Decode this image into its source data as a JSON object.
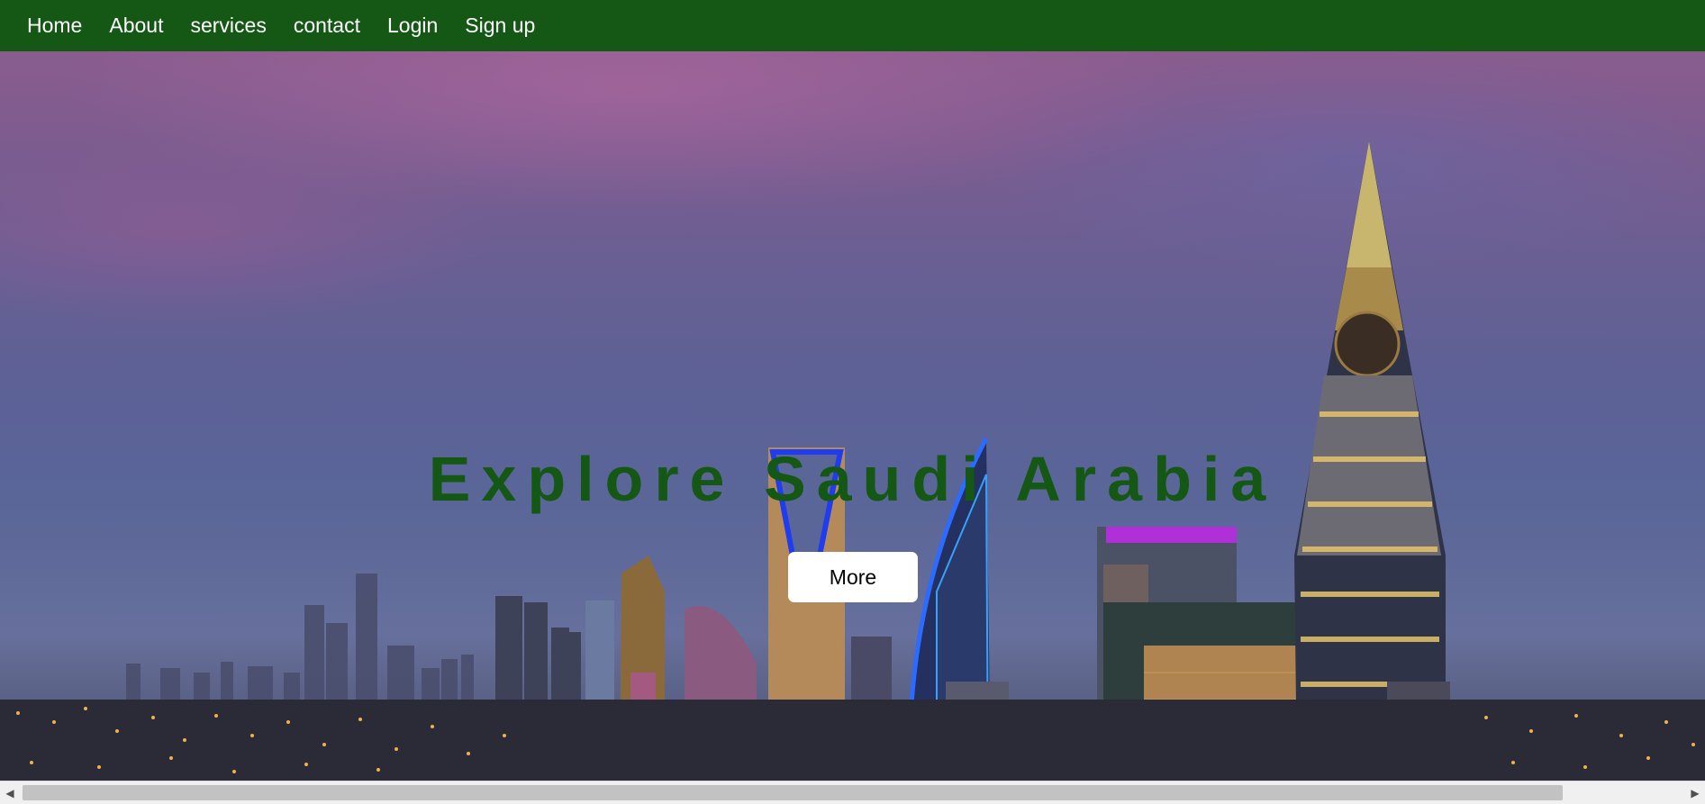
{
  "nav": {
    "items": [
      {
        "label": "Home"
      },
      {
        "label": "About"
      },
      {
        "label": "services"
      },
      {
        "label": "contact"
      },
      {
        "label": "Login"
      },
      {
        "label": "Sign up"
      }
    ]
  },
  "hero": {
    "title": "Explore Saudi Arabia",
    "button_label": "More"
  },
  "scrollbar": {
    "left_icon": "chevron-left-icon",
    "right_icon": "chevron-right-icon"
  },
  "colors": {
    "nav_background": "#155714",
    "title_color": "#155714",
    "button_background": "#ffffff"
  }
}
